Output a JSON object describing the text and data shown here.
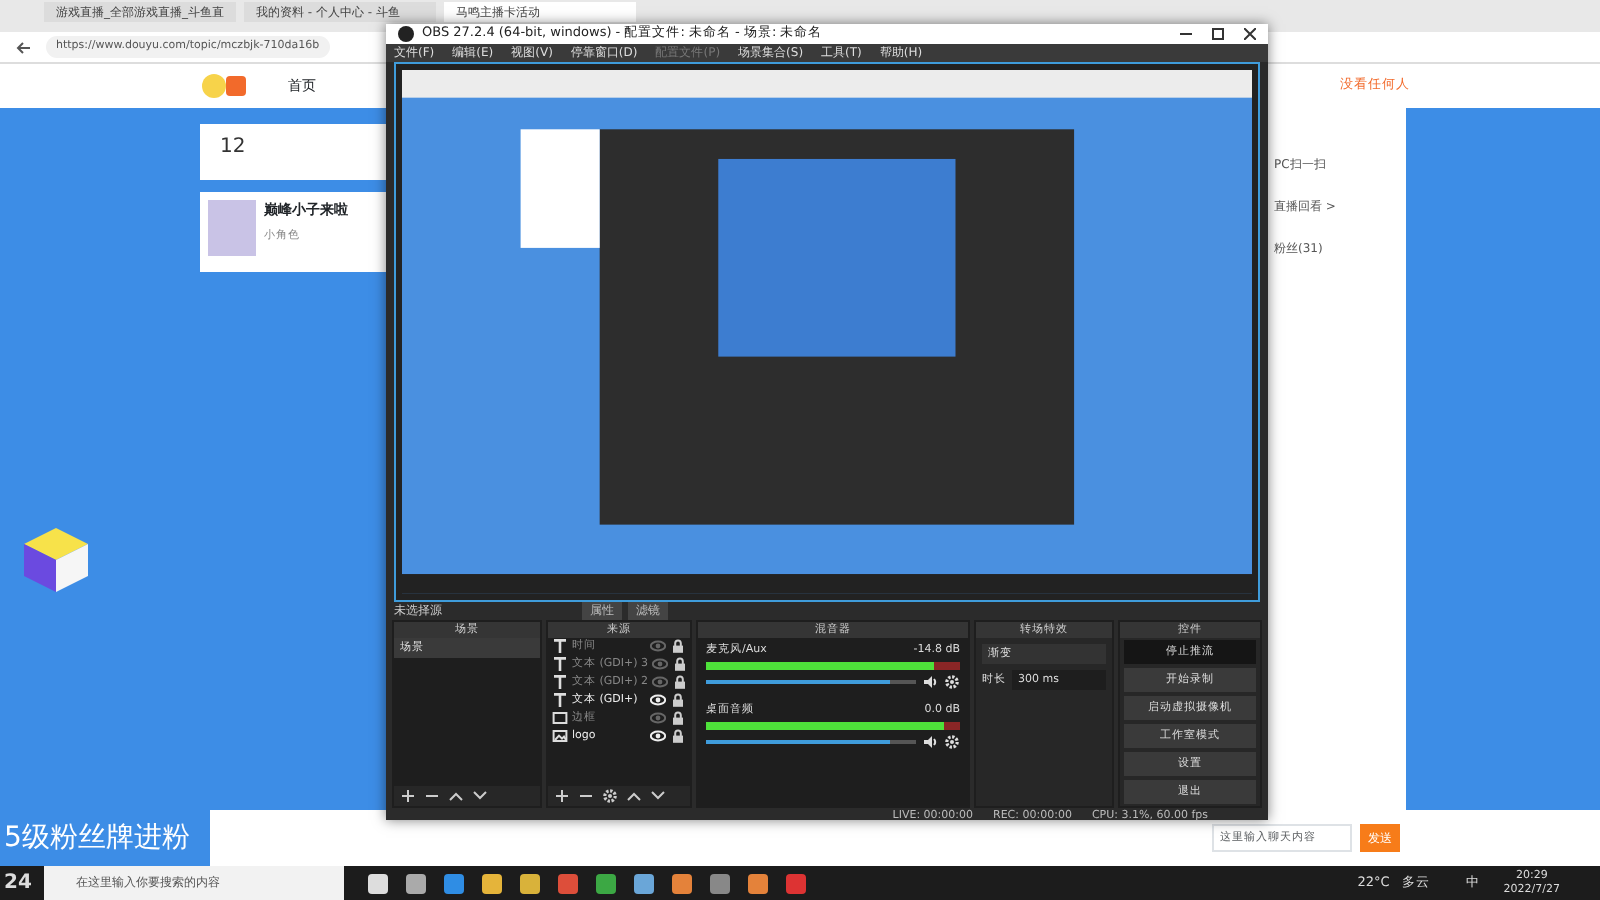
{
  "browser": {
    "tabs": [
      {
        "title": "游戏直播_全部游戏直播_斗鱼直",
        "selected": false
      },
      {
        "title": "我的资料 - 个人中心 - 斗鱼",
        "selected": false
      },
      {
        "title": "马鸣主播卡活动",
        "selected": true
      }
    ],
    "address": "https://www.douyu.com/topic/mczbjk-710da16b"
  },
  "page": {
    "nav": [
      "首页"
    ],
    "stat": "12",
    "card_title": "巅峰小子来啦",
    "card_sub": "小角色",
    "user": "没看任何人",
    "side_texts": [
      "PC扫一扫",
      "直播回看 >",
      "粉丝(31)"
    ],
    "banner": "5级粉丝牌进粉",
    "chat": {
      "placeholder": "这里输入聊天内容",
      "send": "发送"
    }
  },
  "obs": {
    "title": "OBS 27.2.4 (64-bit, windows) - 配置文件: 未命名 - 场景: 未命名",
    "menus": [
      {
        "label": "文件(F)",
        "disabled": false
      },
      {
        "label": "编辑(E)",
        "disabled": false
      },
      {
        "label": "视图(V)",
        "disabled": false
      },
      {
        "label": "停靠窗口(D)",
        "disabled": false
      },
      {
        "label": "配置文件(P)",
        "disabled": true
      },
      {
        "label": "场景集合(S)",
        "disabled": false
      },
      {
        "label": "工具(T)",
        "disabled": false
      },
      {
        "label": "帮助(H)",
        "disabled": false
      }
    ],
    "source_bar": {
      "label": "未选择源",
      "buttons": [
        "属性",
        "滤镜"
      ]
    },
    "scenes": {
      "title": "场景",
      "items": [
        {
          "name": "场景",
          "selected": true
        }
      ]
    },
    "sources": {
      "title": "来源",
      "items": [
        {
          "name": "时间",
          "kind": "text",
          "visible": false
        },
        {
          "name": "文本 (GDI+) 3",
          "kind": "text",
          "visible": false
        },
        {
          "name": "文本 (GDI+) 2",
          "kind": "text",
          "visible": false
        },
        {
          "name": "文本 (GDI+)",
          "kind": "text",
          "visible": true
        },
        {
          "name": "边框",
          "kind": "display",
          "visible": false
        },
        {
          "name": "logo",
          "kind": "image",
          "visible": true
        }
      ]
    },
    "mixer": {
      "title": "混音器",
      "channels": [
        {
          "name": "麦克风/Aux",
          "reading": "-14.8 dB",
          "level": 0.9,
          "volume": {
            "level": 0.88
          }
        },
        {
          "name": "桌面音频",
          "reading": "0.0 dB",
          "level": 0.94,
          "volume": {
            "level": 0.88
          }
        }
      ]
    },
    "transitions": {
      "title": "转场特效",
      "type": "渐变",
      "duration_label": "时长",
      "duration": "300 ms"
    },
    "controls": {
      "title": "控件",
      "buttons": [
        {
          "label": "停止推流",
          "active": true
        },
        {
          "label": "开始录制",
          "active": false
        },
        {
          "label": "启动虚拟摄像机",
          "active": false
        },
        {
          "label": "工作室模式",
          "active": false
        },
        {
          "label": "设置",
          "active": false
        },
        {
          "label": "退出",
          "active": false
        }
      ]
    },
    "status": {
      "live": "LIVE: 00:00:00",
      "rec": "REC: 00:00:00",
      "cpu": "CPU: 3.1%, 60.00 fps"
    }
  },
  "taskbar": {
    "corner": "24",
    "search_placeholder": "在这里输入你要搜索的内容",
    "temperature": "22°C",
    "weather": "多云",
    "ime": "中",
    "time": "20:29",
    "date": "2022/7/27"
  }
}
